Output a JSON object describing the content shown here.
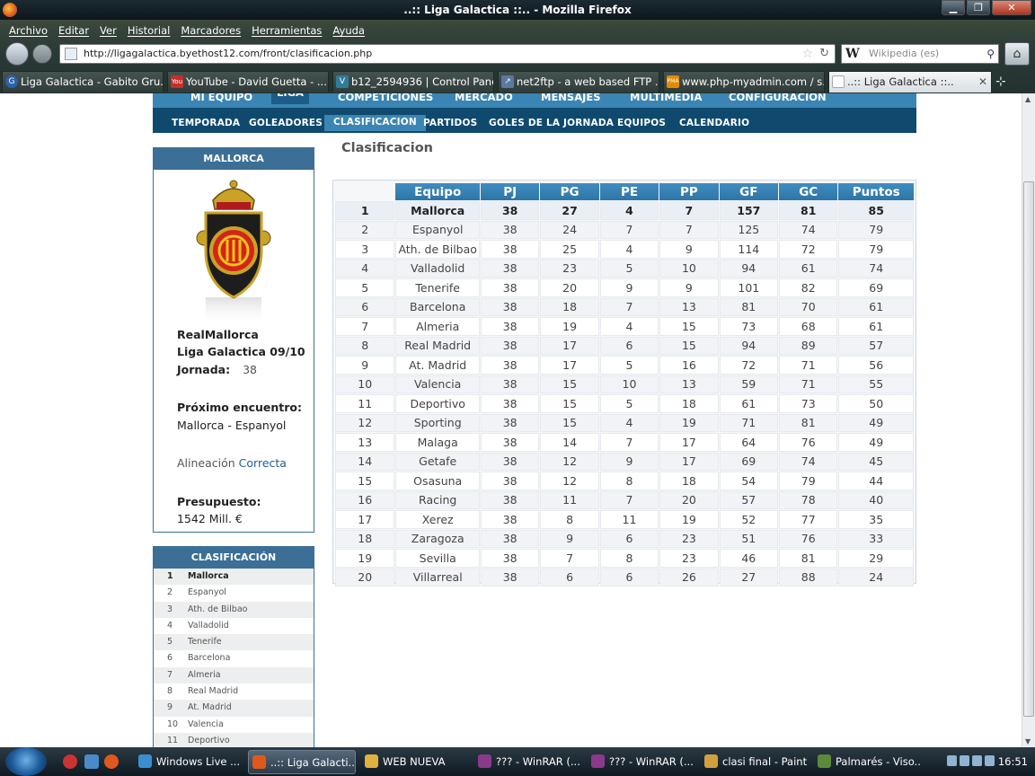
{
  "window": {
    "title": "..:: Liga Galactica ::.. - Mozilla Firefox",
    "minimize": "▁",
    "maximize": "❐",
    "close": "✕"
  },
  "menubar": [
    "Archivo",
    "Editar",
    "Ver",
    "Historial",
    "Marcadores",
    "Herramientas",
    "Ayuda"
  ],
  "address": {
    "url": "http://ligagalactica.byethost12.com/front/clasificacion.php",
    "search_placeholder": "Wikipedia (es)"
  },
  "tabs": [
    {
      "label": "Liga Galactica - Gabito Gru...",
      "icon": "G",
      "color": "#2a61a8"
    },
    {
      "label": "YouTube - David Guetta - ...",
      "icon": "You",
      "color": "#c4302b"
    },
    {
      "label": "b12_2594936 | Control Panel",
      "icon": "V",
      "color": "#2d7d9a"
    },
    {
      "label": "net2ftp - a web based FTP ...",
      "icon": "↗",
      "color": "#5a78a0"
    },
    {
      "label": "www.php-myadmin.com / s...",
      "icon": "PMA",
      "color": "#e48a00"
    },
    {
      "label": "..:: Liga Galactica ::..",
      "icon": "",
      "color": "#dfe5ea"
    }
  ],
  "site_nav": {
    "main": [
      "MI EQUIPO",
      "LIGA",
      "COMPETICIONES",
      "MERCADO",
      "MENSAJES",
      "MULTIMEDIA",
      "CONFIGURACION"
    ],
    "sub": [
      "TEMPORADA",
      "GOLEADORES",
      "CLASIFICACION",
      "PARTIDOS",
      "GOLES DE LA JORNADA",
      "EQUIPOS",
      "CALENDARIO"
    ]
  },
  "club": {
    "header": "MALLORCA",
    "name": "RealMallorca",
    "league": "Liga Galactica 09/10",
    "jornada_label": "Jornada:",
    "jornada_value": "38",
    "next_label": "Próximo encuentro:",
    "next_value": "Mallorca - Espanyol",
    "lineup_label": "Alineación",
    "lineup_value": "Correcta",
    "budget_label": "Presupuesto:",
    "budget_value": "1542 Mill. €"
  },
  "mini_table": {
    "header": "CLASIFICACIÓN",
    "rows": [
      [
        "1",
        "Mallorca"
      ],
      [
        "2",
        "Espanyol"
      ],
      [
        "3",
        "Ath. de Bilbao"
      ],
      [
        "4",
        "Valladolid"
      ],
      [
        "5",
        "Tenerife"
      ],
      [
        "6",
        "Barcelona"
      ],
      [
        "7",
        "Almeria"
      ],
      [
        "8",
        "Real Madrid"
      ],
      [
        "9",
        "At. Madrid"
      ],
      [
        "10",
        "Valencia"
      ],
      [
        "11",
        "Deportivo"
      ]
    ]
  },
  "page_title": "Clasificacion",
  "standings": {
    "columns": [
      "Equipo",
      "PJ",
      "PG",
      "PE",
      "PP",
      "GF",
      "GC",
      "Puntos"
    ],
    "rows": [
      [
        "1",
        "Mallorca",
        "38",
        "27",
        "4",
        "7",
        "157",
        "81",
        "85"
      ],
      [
        "2",
        "Espanyol",
        "38",
        "24",
        "7",
        "7",
        "125",
        "74",
        "79"
      ],
      [
        "3",
        "Ath. de Bilbao",
        "38",
        "25",
        "4",
        "9",
        "114",
        "72",
        "79"
      ],
      [
        "4",
        "Valladolid",
        "38",
        "23",
        "5",
        "10",
        "94",
        "61",
        "74"
      ],
      [
        "5",
        "Tenerife",
        "38",
        "20",
        "9",
        "9",
        "101",
        "82",
        "69"
      ],
      [
        "6",
        "Barcelona",
        "38",
        "18",
        "7",
        "13",
        "81",
        "70",
        "61"
      ],
      [
        "7",
        "Almeria",
        "38",
        "19",
        "4",
        "15",
        "73",
        "68",
        "61"
      ],
      [
        "8",
        "Real Madrid",
        "38",
        "17",
        "6",
        "15",
        "94",
        "89",
        "57"
      ],
      [
        "9",
        "At. Madrid",
        "38",
        "17",
        "5",
        "16",
        "72",
        "71",
        "56"
      ],
      [
        "10",
        "Valencia",
        "38",
        "15",
        "10",
        "13",
        "59",
        "71",
        "55"
      ],
      [
        "11",
        "Deportivo",
        "38",
        "15",
        "5",
        "18",
        "61",
        "73",
        "50"
      ],
      [
        "12",
        "Sporting",
        "38",
        "15",
        "4",
        "19",
        "71",
        "81",
        "49"
      ],
      [
        "13",
        "Malaga",
        "38",
        "14",
        "7",
        "17",
        "64",
        "76",
        "49"
      ],
      [
        "14",
        "Getafe",
        "38",
        "12",
        "9",
        "17",
        "69",
        "74",
        "45"
      ],
      [
        "15",
        "Osasuna",
        "38",
        "12",
        "8",
        "18",
        "54",
        "79",
        "44"
      ],
      [
        "16",
        "Racing",
        "38",
        "11",
        "7",
        "20",
        "57",
        "78",
        "40"
      ],
      [
        "17",
        "Xerez",
        "38",
        "8",
        "11",
        "19",
        "52",
        "77",
        "35"
      ],
      [
        "18",
        "Zaragoza",
        "38",
        "9",
        "6",
        "23",
        "51",
        "76",
        "33"
      ],
      [
        "19",
        "Sevilla",
        "38",
        "7",
        "8",
        "23",
        "46",
        "81",
        "29"
      ],
      [
        "20",
        "Villarreal",
        "38",
        "6",
        "6",
        "26",
        "27",
        "88",
        "24"
      ]
    ]
  },
  "taskbar": {
    "items": [
      {
        "label": "Windows Live ...",
        "color": "#3b8fd0"
      },
      {
        "label": "..:: Liga Galacti...",
        "color": "#e1581d",
        "active": true
      },
      {
        "label": "WEB NUEVA",
        "color": "#e0b040"
      },
      {
        "label": "??? - WinRAR (...",
        "color": "#8a3a8a"
      },
      {
        "label": "??? - WinRAR (...",
        "color": "#8a3a8a"
      },
      {
        "label": "clasi final - Paint",
        "color": "#d0a040"
      },
      {
        "label": "Palmarés - Viso...",
        "color": "#5a8a3a"
      }
    ],
    "clock": "16:51"
  }
}
